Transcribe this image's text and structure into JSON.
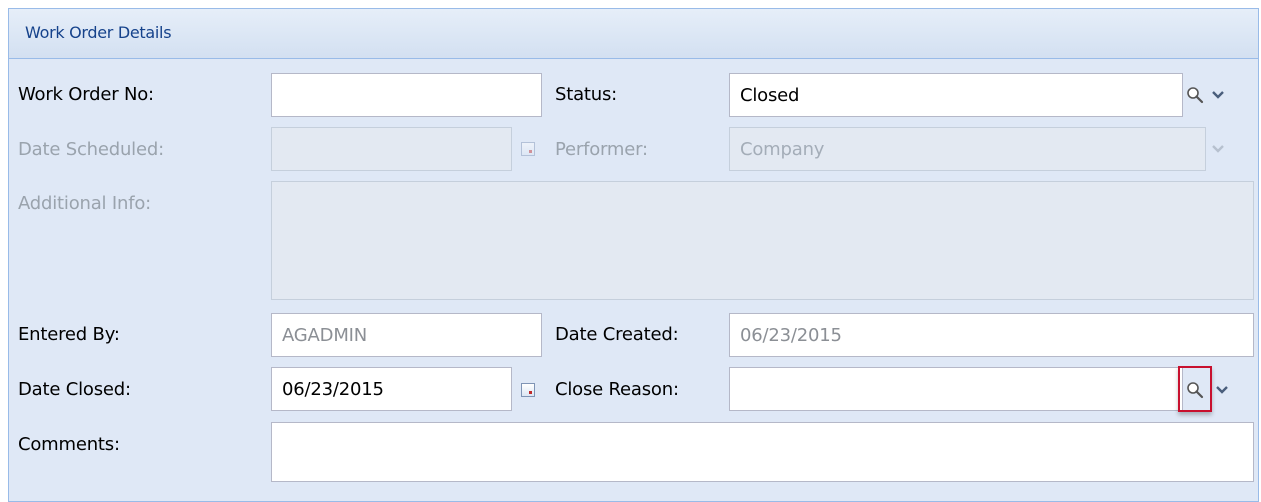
{
  "panel": {
    "title": "Work Order Details"
  },
  "labels": {
    "work_order_no": "Work Order No:",
    "status": "Status:",
    "date_scheduled": "Date Scheduled:",
    "performer": "Performer:",
    "additional_info": "Additional Info:",
    "entered_by": "Entered By:",
    "date_created": "Date Created:",
    "date_closed": "Date Closed:",
    "close_reason": "Close Reason:",
    "comments": "Comments:"
  },
  "values": {
    "work_order_no": "",
    "status": "Closed",
    "date_scheduled": "",
    "performer": "Company",
    "additional_info": "",
    "entered_by": "AGADMIN",
    "date_created": "06/23/2015",
    "date_closed": "06/23/2015",
    "close_reason": "",
    "comments": ""
  },
  "colors": {
    "panel_bg": "#dfe8f6",
    "panel_border": "#99bbe8",
    "highlight": "#c8102e"
  },
  "icons": {
    "search": "magnifier-icon",
    "dropdown": "chevron-down-icon",
    "calendar": "calendar-icon"
  }
}
